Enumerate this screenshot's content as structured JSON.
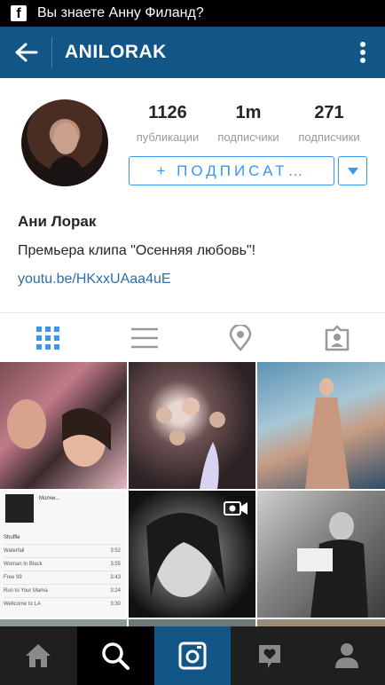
{
  "status_bar": {
    "app_badge": "f",
    "notification": "Вы знаете Анну Филанд?"
  },
  "app_bar": {
    "title": "ANILORAK",
    "back_icon": "arrow-left-icon",
    "menu_icon": "more-vertical-icon",
    "color": "#125688"
  },
  "profile": {
    "stats": [
      {
        "value": "1126",
        "label": "публикации"
      },
      {
        "value": "1m",
        "label": "подписчики"
      },
      {
        "value": "271",
        "label": "подписчики"
      }
    ],
    "follow_button": "+ ПОДПИСАТ…",
    "display_name": "Ани Лорак",
    "bio": "Премьера клипа \"Осенняя любовь\"!",
    "link": "youtu.be/HKxxUAaa4uE",
    "accent_color": "#3897f0"
  },
  "tabs": [
    {
      "name": "grid",
      "icon": "grid-icon",
      "active": true
    },
    {
      "name": "list",
      "icon": "list-icon",
      "active": false
    },
    {
      "name": "map",
      "icon": "map-pin-icon",
      "active": false
    },
    {
      "name": "tagged",
      "icon": "tagged-icon",
      "active": false
    }
  ],
  "grid_posts": {
    "music_screenshot": {
      "album_title": "Молчи...",
      "shuffle": "Shuffle",
      "tracks": [
        {
          "title": "Waterfall",
          "time": "3:52"
        },
        {
          "title": "Woman In Black",
          "time": "3:55"
        },
        {
          "title": "Free 99",
          "time": "3:43"
        },
        {
          "title": "Run to Your Mama",
          "time": "3:24"
        },
        {
          "title": "Wellcome to LA",
          "time": "3:30"
        }
      ]
    }
  },
  "bottom_nav": [
    {
      "icon": "home-icon"
    },
    {
      "icon": "search-icon",
      "active": true
    },
    {
      "icon": "camera-icon"
    },
    {
      "icon": "activity-heart-icon"
    },
    {
      "icon": "profile-icon"
    }
  ]
}
